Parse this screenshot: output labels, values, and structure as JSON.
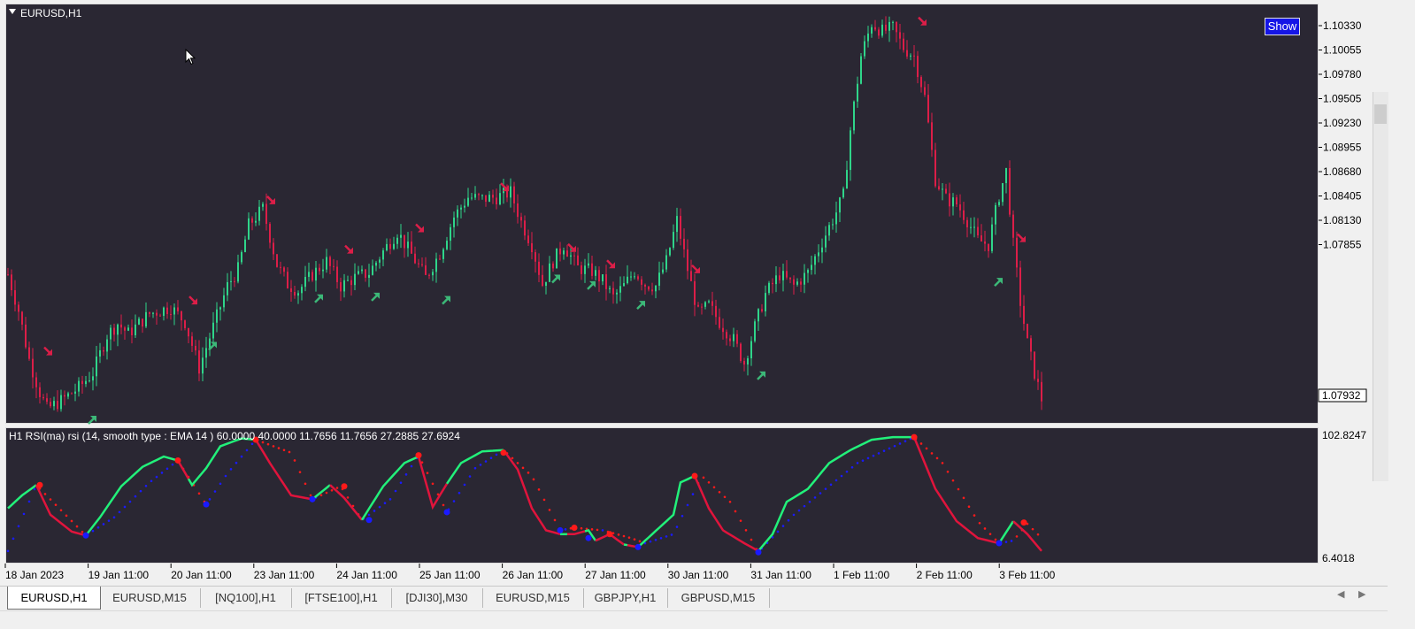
{
  "window": {
    "symbol_title": "EURUSD,H1",
    "show_button": "Show"
  },
  "colors": {
    "background": "#2a2733",
    "bull": "#2fd58a",
    "bear": "#dc1e48",
    "rsi_up": "#22f07a",
    "rsi_down": "#e0143c",
    "signal_up": "#1a1aff",
    "signal_down": "#ff1a1a",
    "axis_text": "#000000",
    "accent_button": "#1515e6"
  },
  "price_axis": {
    "labels": [
      "1.10330",
      "1.10055",
      "1.09780",
      "1.09505",
      "1.09230",
      "1.08955",
      "1.08680",
      "1.08405",
      "1.08130",
      "1.07855"
    ],
    "current_price": "1.07932"
  },
  "time_axis": {
    "labels": [
      "18 Jan 2023",
      "19 Jan 11:00",
      "20 Jan 11:00",
      "23 Jan 11:00",
      "24 Jan 11:00",
      "25 Jan 11:00",
      "26 Jan 11:00",
      "27 Jan 11:00",
      "30 Jan 11:00",
      "31 Jan 11:00",
      "1 Feb 11:00",
      "2 Feb 11:00",
      "3 Feb 11:00"
    ]
  },
  "indicator": {
    "title": "H1 RSI(ma) rsi (14, smooth type : EMA  14 ) 60.0000 40.0000 11.7656 11.7656 27.2885 27.6924",
    "axis_max": "102.8247",
    "axis_min": "6.4018"
  },
  "tabs": [
    {
      "label": "EURUSD,H1",
      "active": true
    },
    {
      "label": "EURUSD,M15",
      "active": false
    },
    {
      "label": "[NQ100],H1",
      "active": false
    },
    {
      "label": "[FTSE100],H1",
      "active": false
    },
    {
      "label": "[DJI30],M30",
      "active": false
    },
    {
      "label": "EURUSD,M15",
      "active": false
    },
    {
      "label": "GBPJPY,H1",
      "active": false
    },
    {
      "label": "GBPUSD,M15",
      "active": false
    }
  ],
  "chart_data": {
    "type": "candlestick",
    "symbol": "EURUSD",
    "timeframe": "H1",
    "ylim": [
      1.0781,
      1.1037
    ],
    "price_path": [
      [
        0,
        1.0872
      ],
      [
        3,
        1.085
      ],
      [
        6,
        1.082
      ],
      [
        9,
        1.08
      ],
      [
        11,
        1.079
      ],
      [
        15,
        1.0795
      ],
      [
        20,
        1.0803
      ],
      [
        24,
        1.0812
      ],
      [
        28,
        1.0835
      ],
      [
        31,
        1.0842
      ],
      [
        34,
        1.0836
      ],
      [
        40,
        1.0848
      ],
      [
        46,
        1.0852
      ],
      [
        50,
        1.0843
      ],
      [
        54,
        1.0815
      ],
      [
        58,
        1.084
      ],
      [
        62,
        1.0865
      ],
      [
        65,
        1.0875
      ],
      [
        68,
        1.0902
      ],
      [
        72,
        1.0912
      ],
      [
        76,
        1.0878
      ],
      [
        79,
        1.0866
      ],
      [
        82,
        1.0862
      ],
      [
        86,
        1.0872
      ],
      [
        90,
        1.088
      ],
      [
        94,
        1.0865
      ],
      [
        98,
        1.087
      ],
      [
        102,
        1.0873
      ],
      [
        106,
        1.0886
      ],
      [
        110,
        1.0898
      ],
      [
        114,
        1.0884
      ],
      [
        118,
        1.087
      ],
      [
        122,
        1.0885
      ],
      [
        126,
        1.0907
      ],
      [
        130,
        1.0919
      ],
      [
        134,
        1.0918
      ],
      [
        138,
        1.0919
      ],
      [
        142,
        1.0922
      ],
      [
        145,
        1.0904
      ],
      [
        148,
        1.089
      ],
      [
        151,
        1.0866
      ],
      [
        154,
        1.088
      ],
      [
        157,
        1.089
      ],
      [
        161,
        1.0876
      ],
      [
        165,
        1.0874
      ],
      [
        168,
        1.0868
      ],
      [
        171,
        1.0858
      ],
      [
        174,
        1.0865
      ],
      [
        177,
        1.0874
      ],
      [
        180,
        1.0866
      ],
      [
        183,
        1.0865
      ],
      [
        186,
        1.088
      ],
      [
        189,
        1.0905
      ],
      [
        192,
        1.0875
      ],
      [
        195,
        1.0848
      ],
      [
        198,
        1.0853
      ],
      [
        201,
        1.0843
      ],
      [
        205,
        1.0832
      ],
      [
        208,
        1.0818
      ],
      [
        211,
        1.084
      ],
      [
        214,
        1.086
      ],
      [
        218,
        1.0872
      ],
      [
        222,
        1.0865
      ],
      [
        226,
        1.0873
      ],
      [
        230,
        1.0892
      ],
      [
        234,
        1.091
      ],
      [
        236,
        1.092
      ],
      [
        238,
        1.096
      ],
      [
        241,
        1.1005
      ],
      [
        244,
        1.1025
      ],
      [
        247,
        1.102
      ],
      [
        250,
        1.1022
      ],
      [
        253,
        1.101
      ],
      [
        256,
        1.1005
      ],
      [
        259,
        1.098
      ],
      [
        262,
        1.093
      ],
      [
        265,
        1.0918
      ],
      [
        268,
        1.0915
      ],
      [
        271,
        1.0905
      ],
      [
        274,
        1.0893
      ],
      [
        277,
        1.089
      ],
      [
        280,
        1.092
      ],
      [
        282,
        1.0935
      ],
      [
        284,
        1.089
      ],
      [
        286,
        1.0855
      ],
      [
        288,
        1.083
      ],
      [
        290,
        1.0812
      ],
      [
        292,
        1.0796
      ]
    ],
    "sell_signals": [
      [
        9,
        1.082
      ],
      [
        50,
        1.0851
      ],
      [
        72,
        1.0912
      ],
      [
        94,
        1.0882
      ],
      [
        114,
        1.0895
      ],
      [
        138,
        1.092
      ],
      [
        157,
        1.0883
      ],
      [
        168,
        1.0873
      ],
      [
        192,
        1.087
      ],
      [
        256,
        1.1021
      ],
      [
        284,
        1.0889
      ]
    ],
    "buy_signals": [
      [
        22,
        1.0788
      ],
      [
        56,
        1.0833
      ],
      [
        86,
        1.0862
      ],
      [
        102,
        1.0863
      ],
      [
        122,
        1.0861
      ],
      [
        153,
        1.0874
      ],
      [
        163,
        1.087
      ],
      [
        177,
        1.0858
      ],
      [
        211,
        1.0815
      ],
      [
        278,
        1.0872
      ]
    ],
    "rsi": {
      "ylim": [
        6.4018,
        102.8247
      ],
      "main_path": [
        [
          0,
          45
        ],
        [
          4,
          55
        ],
        [
          8,
          63
        ],
        [
          12,
          40
        ],
        [
          18,
          27
        ],
        [
          22,
          24
        ],
        [
          26,
          38
        ],
        [
          32,
          62
        ],
        [
          38,
          77
        ],
        [
          44,
          85
        ],
        [
          48,
          82
        ],
        [
          52,
          63
        ],
        [
          56,
          76
        ],
        [
          60,
          93
        ],
        [
          66,
          99
        ],
        [
          70,
          98
        ],
        [
          74,
          80
        ],
        [
          80,
          55
        ],
        [
          86,
          52
        ],
        [
          91,
          63
        ],
        [
          95,
          53
        ],
        [
          100,
          36
        ],
        [
          106,
          62
        ],
        [
          112,
          80
        ],
        [
          116,
          85
        ],
        [
          120,
          46
        ],
        [
          124,
          64
        ],
        [
          128,
          80
        ],
        [
          134,
          89
        ],
        [
          140,
          90
        ],
        [
          144,
          75
        ],
        [
          148,
          45
        ],
        [
          152,
          28
        ],
        [
          156,
          25
        ],
        [
          160,
          25
        ],
        [
          164,
          28
        ],
        [
          166,
          20
        ],
        [
          170,
          25
        ],
        [
          174,
          17
        ],
        [
          178,
          15
        ],
        [
          180,
          20
        ],
        [
          184,
          30
        ],
        [
          188,
          40
        ],
        [
          190,
          65
        ],
        [
          194,
          70
        ],
        [
          198,
          45
        ],
        [
          202,
          28
        ],
        [
          208,
          18
        ],
        [
          212,
          12
        ],
        [
          216,
          25
        ],
        [
          220,
          50
        ],
        [
          226,
          60
        ],
        [
          232,
          80
        ],
        [
          238,
          90
        ],
        [
          244,
          98
        ],
        [
          250,
          100
        ],
        [
          256,
          100
        ],
        [
          262,
          60
        ],
        [
          268,
          35
        ],
        [
          274,
          22
        ],
        [
          280,
          18
        ],
        [
          284,
          35
        ],
        [
          288,
          25
        ],
        [
          292,
          12
        ]
      ],
      "main_up_ranges": [
        [
          0,
          8
        ],
        [
          22,
          48
        ],
        [
          51,
          70
        ],
        [
          86,
          91
        ],
        [
          100,
          116
        ],
        [
          124,
          140
        ],
        [
          156,
          158
        ],
        [
          163,
          166
        ],
        [
          174,
          175
        ],
        [
          178,
          194
        ],
        [
          212,
          256
        ],
        [
          280,
          284
        ]
      ],
      "signal_path": [
        [
          0,
          12
        ],
        [
          8,
          63
        ],
        [
          22,
          24
        ],
        [
          30,
          38
        ],
        [
          40,
          65
        ],
        [
          48,
          82
        ],
        [
          56,
          48
        ],
        [
          62,
          72
        ],
        [
          70,
          98
        ],
        [
          80,
          88
        ],
        [
          86,
          52
        ],
        [
          94,
          62
        ],
        [
          100,
          36
        ],
        [
          108,
          52
        ],
        [
          116,
          86
        ],
        [
          124,
          42
        ],
        [
          132,
          76
        ],
        [
          140,
          90
        ],
        [
          148,
          70
        ],
        [
          156,
          28
        ],
        [
          160,
          30
        ],
        [
          168,
          28
        ],
        [
          176,
          22
        ],
        [
          180,
          18
        ],
        [
          188,
          25
        ],
        [
          196,
          70
        ],
        [
          204,
          50
        ],
        [
          212,
          11
        ],
        [
          222,
          40
        ],
        [
          240,
          80
        ],
        [
          256,
          100
        ],
        [
          264,
          80
        ],
        [
          274,
          35
        ],
        [
          280,
          18
        ],
        [
          284,
          20
        ],
        [
          288,
          33
        ],
        [
          292,
          22
        ]
      ],
      "signal_up_ranges": [
        [
          0,
          8
        ],
        [
          22,
          48
        ],
        [
          56,
          70
        ],
        [
          86,
          88
        ],
        [
          100,
          116
        ],
        [
          124,
          140
        ],
        [
          156,
          159
        ],
        [
          168,
          169
        ],
        [
          180,
          194
        ],
        [
          212,
          256
        ],
        [
          280,
          285
        ]
      ],
      "peak_dots": [
        [
          9,
          63
        ],
        [
          48,
          82
        ],
        [
          70,
          98
        ],
        [
          95,
          62
        ],
        [
          116,
          86
        ],
        [
          140,
          88
        ],
        [
          160,
          30
        ],
        [
          170,
          25
        ],
        [
          194,
          70
        ],
        [
          256,
          100
        ],
        [
          287,
          34
        ]
      ],
      "trough_dots": [
        [
          22,
          24
        ],
        [
          56,
          48
        ],
        [
          86,
          52
        ],
        [
          102,
          36
        ],
        [
          124,
          42
        ],
        [
          156,
          28
        ],
        [
          164,
          22
        ],
        [
          178,
          15
        ],
        [
          212,
          11
        ],
        [
          280,
          18
        ]
      ]
    }
  }
}
